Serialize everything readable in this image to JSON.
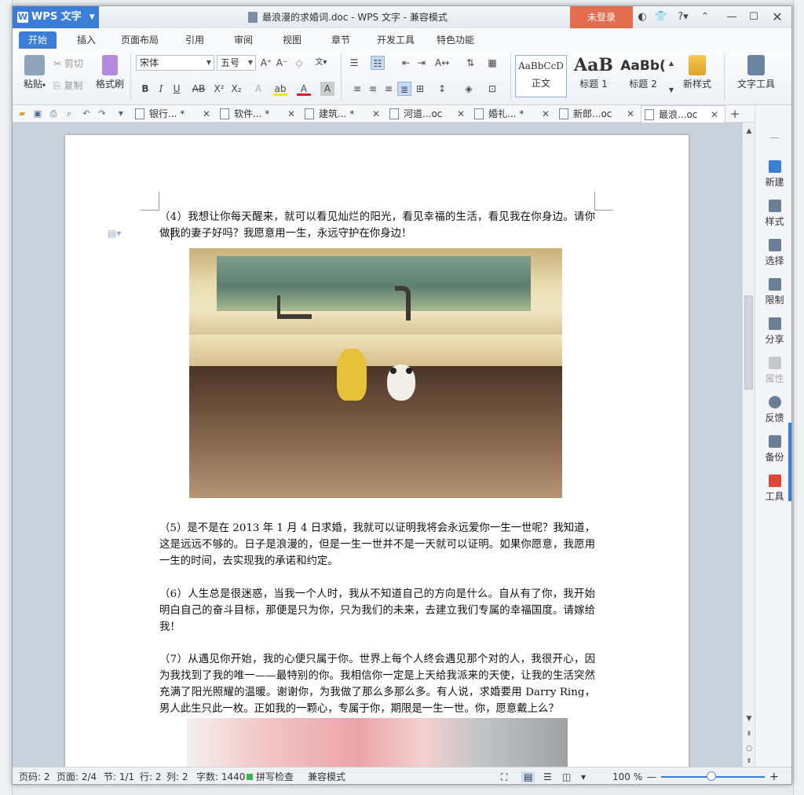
{
  "app": {
    "logo_label": "WPS 文字",
    "window_title": "最浪漫的求婚词.doc - WPS 文字 - 兼容模式",
    "login_label": "未登录"
  },
  "ribbon_tabs": [
    "开始",
    "插入",
    "页面布局",
    "引用",
    "审阅",
    "视图",
    "章节",
    "开发工具",
    "特色功能"
  ],
  "ribbon": {
    "paste": "粘贴",
    "cut": "剪切",
    "copy": "复制",
    "format_painter": "格式刷",
    "font_name": "宋体",
    "font_size": "五号",
    "styles": [
      {
        "preview": "AaBbCcD",
        "name": "正文"
      },
      {
        "preview": "AaB",
        "name": "标题 1"
      },
      {
        "preview": "AaBb(",
        "name": "标题 2"
      }
    ],
    "new_style": "新样式",
    "text_tools": "文字工具"
  },
  "doc_tabs": [
    {
      "label": "银行... *"
    },
    {
      "label": "软件... *"
    },
    {
      "label": "建筑... *"
    },
    {
      "label": "河道...oc"
    },
    {
      "label": "婚礼... *"
    },
    {
      "label": "新郎...oc"
    },
    {
      "label": "最浪...oc"
    }
  ],
  "document": {
    "p4": "（4）我想让你每天醒来，就可以看见灿烂的阳光，看见幸福的生活，看见我在你身边。请你做我的妻子好吗？我愿意用一生，永远守护在你身边！",
    "p5": "（5）是不是在 2013 年 1 月 4 日求婚，我就可以证明我将会永远爱你一生一世呢？我知道，这是远远不够的。日子是浪漫的，但是一生一世并不是一天就可以证明。如果你愿意，我愿用一生的时间，去实现我的承诺和约定。",
    "p6": "（6）人生总是很迷惑，当我一个人时，我从不知道自己的方向是什么。自从有了你，我开始明白自己的奋斗目标，那便是只为你，只为我们的未来，去建立我们专属的幸福国度。请嫁给我！",
    "p7": "（7）从遇见你开始，我的心便只属于你。世界上每个人终会遇见那个对的人，我很开心，因为我找到了我的唯一——最特别的你。我相信你一定是上天给我派来的天使，让我的生活突然充满了阳光照耀的温暖。谢谢你，为我做了那么多那么多。有人说，求婚要用 Darry Ring，男人此生只此一枚。正如我的一颗心，专属于你，期限是一生一世。你，愿意戴上么？"
  },
  "side_panel": [
    "新建",
    "样式",
    "选择",
    "限制",
    "分享",
    "属性",
    "反馈",
    "备份",
    "工具"
  ],
  "status": {
    "page": "页码: 2",
    "pages": "页面: 2/4",
    "section": "节: 1/1",
    "row": "行: 2",
    "col": "列: 2",
    "words": "字数: 1440",
    "spell": "拼写检查",
    "mode": "兼容模式",
    "zoom": "100 %"
  }
}
